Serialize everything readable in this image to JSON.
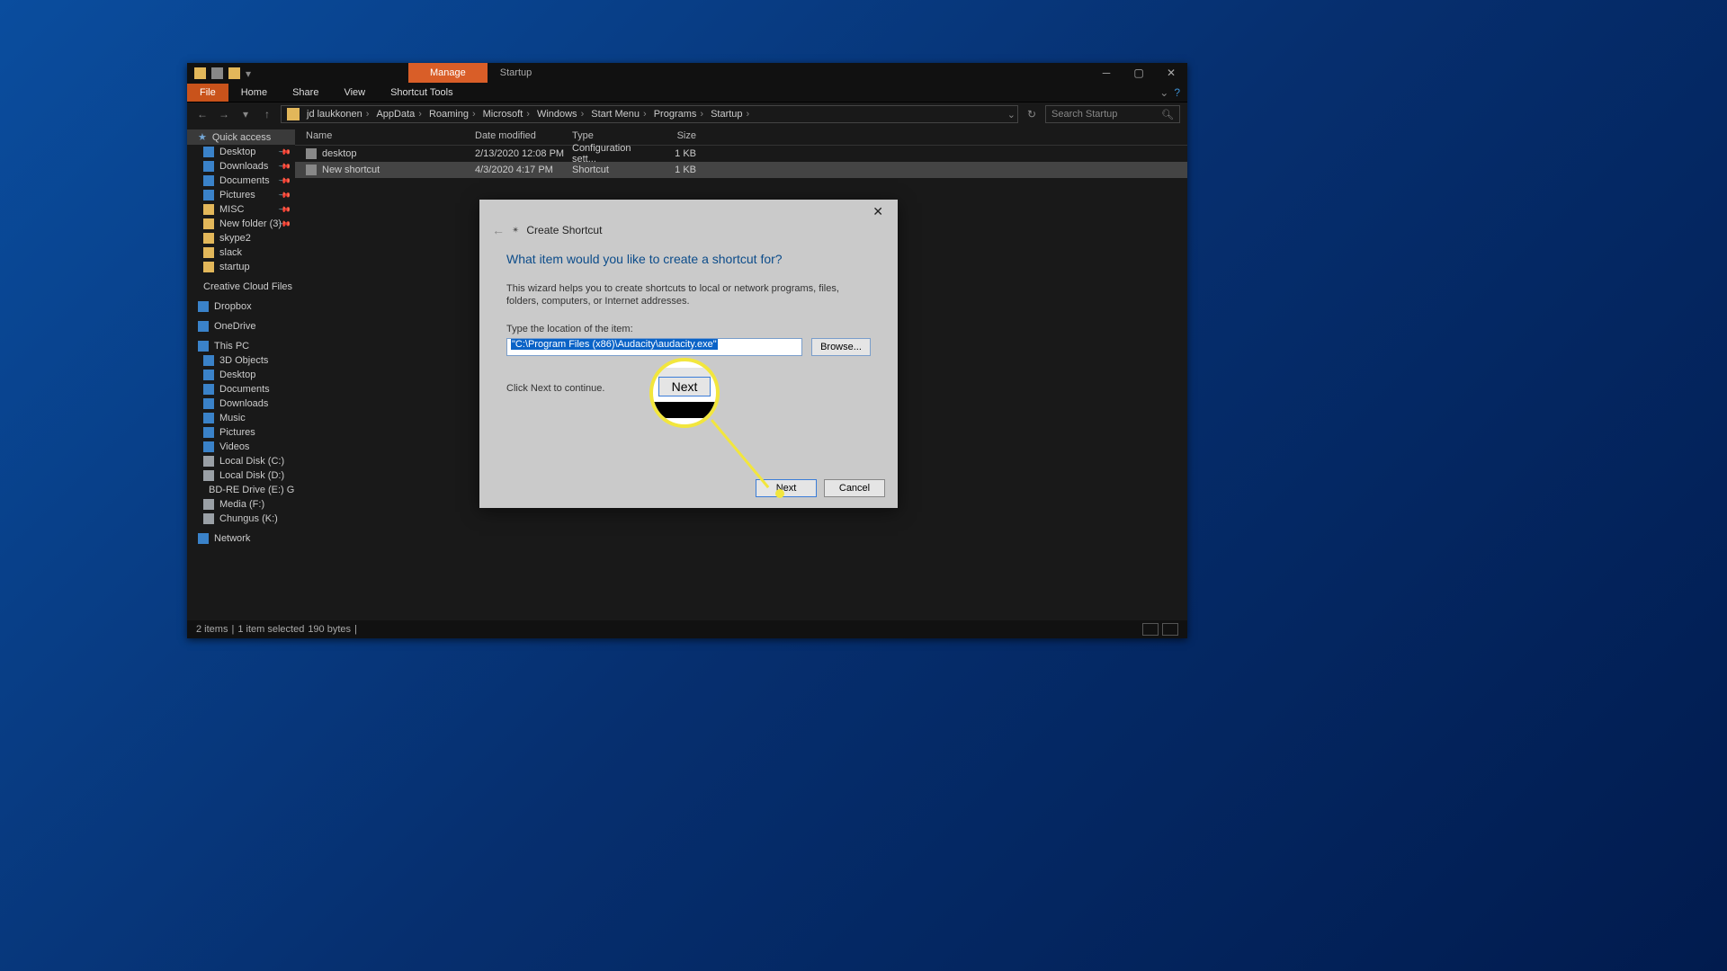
{
  "window": {
    "manage_tab": "Manage",
    "title": "Startup",
    "ribbon": {
      "file": "File",
      "home": "Home",
      "share": "Share",
      "view": "View",
      "shortcut_tools": "Shortcut Tools"
    },
    "breadcrumb": [
      "jd laukkonen",
      "AppData",
      "Roaming",
      "Microsoft",
      "Windows",
      "Start Menu",
      "Programs",
      "Startup"
    ],
    "search_placeholder": "Search Startup"
  },
  "sidebar": {
    "quick_access": {
      "label": "Quick access",
      "items": [
        {
          "label": "Desktop",
          "pinned": true
        },
        {
          "label": "Downloads",
          "pinned": true
        },
        {
          "label": "Documents",
          "pinned": true
        },
        {
          "label": "Pictures",
          "pinned": true
        },
        {
          "label": "MISC",
          "pinned": true
        },
        {
          "label": "New folder (3)",
          "pinned": true
        },
        {
          "label": "skype2"
        },
        {
          "label": "slack"
        },
        {
          "label": "startup"
        }
      ]
    },
    "creative_cloud": "Creative Cloud Files",
    "dropbox": "Dropbox",
    "onedrive": "OneDrive",
    "thispc": {
      "label": "This PC",
      "items": [
        {
          "label": "3D Objects"
        },
        {
          "label": "Desktop"
        },
        {
          "label": "Documents"
        },
        {
          "label": "Downloads"
        },
        {
          "label": "Music"
        },
        {
          "label": "Pictures"
        },
        {
          "label": "Videos"
        },
        {
          "label": "Local Disk (C:)"
        },
        {
          "label": "Local Disk (D:)"
        },
        {
          "label": "BD-RE Drive (E:) GG"
        },
        {
          "label": "Media (F:)"
        },
        {
          "label": "Chungus (K:)"
        }
      ]
    },
    "network": "Network"
  },
  "columns": {
    "name": "Name",
    "date": "Date modified",
    "type": "Type",
    "size": "Size"
  },
  "files": [
    {
      "name": "desktop",
      "date": "2/13/2020 12:08 PM",
      "type": "Configuration sett...",
      "size": "1 KB"
    },
    {
      "name": "New shortcut",
      "date": "4/3/2020 4:17 PM",
      "type": "Shortcut",
      "size": "1 KB",
      "selected": true
    }
  ],
  "statusbar": {
    "items": "2 items",
    "selected": "1 item selected",
    "bytes": "190 bytes"
  },
  "dialog": {
    "title": "Create Shortcut",
    "heading": "What item would you like to create a shortcut for?",
    "description": "This wizard helps you to create shortcuts to local or network programs, files, folders, computers, or Internet addresses.",
    "location_label": "Type the location of the item:",
    "location_value": "\"C:\\Program Files (x86)\\Audacity\\audacity.exe\"",
    "browse": "Browse...",
    "continue_hint": "Click Next to continue.",
    "next": "Next",
    "cancel": "Cancel"
  },
  "annotation": {
    "zoom_label": "Next"
  }
}
